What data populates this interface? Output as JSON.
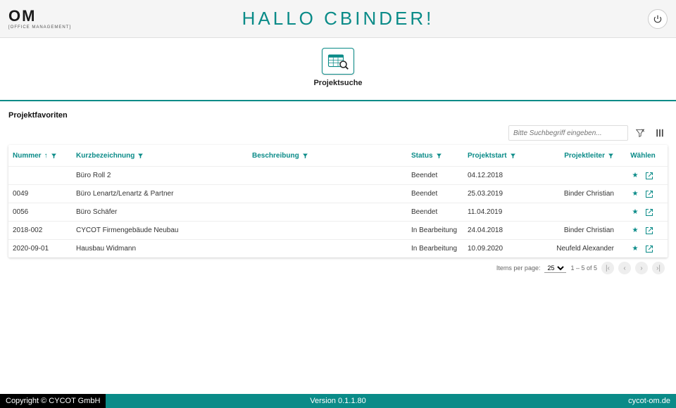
{
  "brand": {
    "name": "OM",
    "sub": "[OFFICE MANAGEMENT]"
  },
  "page_title": "HALLO CBINDER!",
  "project_search_label": "Projektsuche",
  "section_title": "Projektfavoriten",
  "filter_placeholder": "Bitte Suchbegriff eingeben...",
  "columns": {
    "nummer": "Nummer",
    "kurz": "Kurzbezeichnung",
    "besch": "Beschreibung",
    "status": "Status",
    "start": "Projektstart",
    "leiter": "Projektleiter",
    "waehlen": "Wählen"
  },
  "rows": [
    {
      "nummer": "",
      "kurz": "Büro Roll 2",
      "status": "Beendet",
      "start": "04.12.2018",
      "leiter": ""
    },
    {
      "nummer": "0049",
      "kurz": "Büro Lenartz/Lenartz & Partner",
      "status": "Beendet",
      "start": "25.03.2019",
      "leiter": "Binder Christian"
    },
    {
      "nummer": "0056",
      "kurz": "Büro Schäfer",
      "status": "Beendet",
      "start": "11.04.2019",
      "leiter": ""
    },
    {
      "nummer": "2018-002",
      "kurz": "CYCOT Firmengebäude Neubau",
      "status": "In Bearbeitung",
      "start": "24.04.2018",
      "leiter": "Binder Christian"
    },
    {
      "nummer": "2020-09-01",
      "kurz": "Hausbau Widmann",
      "status": "In Bearbeitung",
      "start": "10.09.2020",
      "leiter": "Neufeld Alexander"
    }
  ],
  "pager": {
    "items_per_page_label": "Items per page:",
    "page_size": "25",
    "range": "1 – 5 of 5"
  },
  "footer": {
    "copyright": "Copyright © CYCOT GmbH",
    "version": "Version 0.1.1.80",
    "link": "cycot-om.de"
  }
}
